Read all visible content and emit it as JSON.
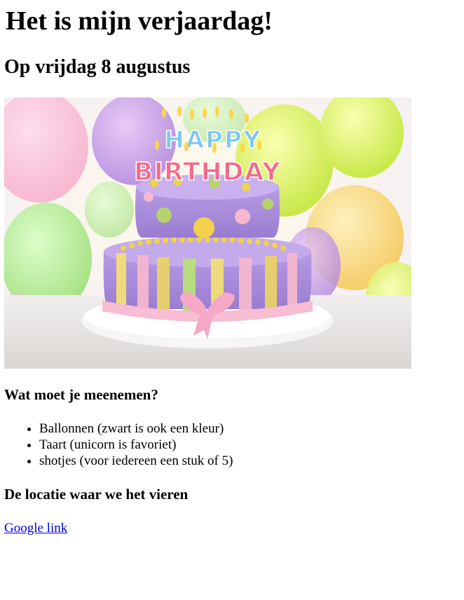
{
  "header": {
    "title": "Het is mijn verjaardag!",
    "subtitle": "Op vrijdag 8 augustus"
  },
  "image": {
    "candle_text_line1": "HAPPY",
    "candle_text_line2": "BIRTHDAY"
  },
  "bring": {
    "heading": "Wat moet je meenemen?",
    "items": [
      "Ballonnen (zwart is ook een kleur)",
      "Taart (unicorn is favoriet)",
      "shotjes (voor iedereen een stuk of 5)"
    ]
  },
  "location": {
    "heading": "De locatie waar we het vieren",
    "link_label": "Google link"
  },
  "colors": {
    "link": "#0000ee",
    "text": "#000000",
    "background": "#ffffff"
  }
}
